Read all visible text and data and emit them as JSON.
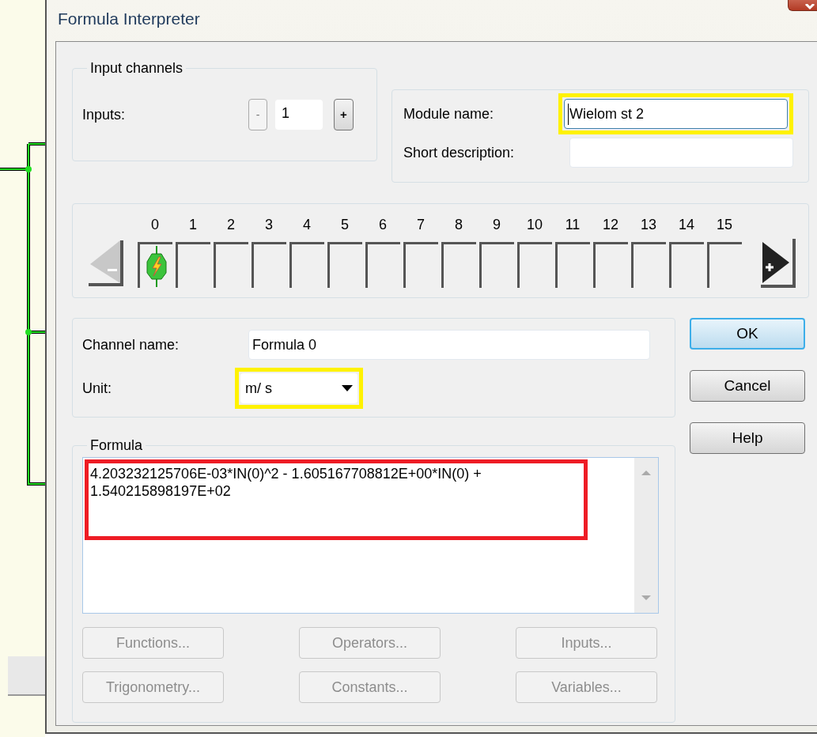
{
  "window": {
    "title": "Formula Interpreter"
  },
  "input_channels": {
    "title": "Input channels",
    "label": "Inputs:",
    "decrement": "-",
    "value": "1",
    "increment": "+"
  },
  "module": {
    "name_label": "Module name:",
    "name_value": "Wielom st 2",
    "name_focused": true,
    "name_highlighted": true,
    "description_label": "Short description:"
  },
  "channels": [
    {
      "label": "0",
      "active": true
    },
    {
      "label": "1",
      "active": false
    },
    {
      "label": "2",
      "active": false
    },
    {
      "label": "3",
      "active": false
    },
    {
      "label": "4",
      "active": false
    },
    {
      "label": "5",
      "active": false
    },
    {
      "label": "6",
      "active": false
    },
    {
      "label": "7",
      "active": false
    },
    {
      "label": "8",
      "active": false
    },
    {
      "label": "9",
      "active": false
    },
    {
      "label": "10",
      "active": false
    },
    {
      "label": "11",
      "active": false
    },
    {
      "label": "12",
      "active": false
    },
    {
      "label": "13",
      "active": false
    },
    {
      "label": "14",
      "active": false
    },
    {
      "label": "15",
      "active": false
    }
  ],
  "channel": {
    "name_label": "Channel name:",
    "name_value": "Formula 0",
    "unit_label": "Unit:",
    "unit_value": "m/ s",
    "unit_highlighted": true
  },
  "formula": {
    "title": "Formula",
    "text": "4.203232125706E-03*IN(0)^2 - 1.605167708812E+00*IN(0) + 1.540215898197E+02",
    "highlighted": true,
    "buttons": [
      {
        "label": "Functions...",
        "disabled": true
      },
      {
        "label": "Operators...",
        "disabled": true
      },
      {
        "label": "Inputs...",
        "disabled": true
      },
      {
        "label": "Trigonometry...",
        "disabled": true
      },
      {
        "label": "Constants...",
        "disabled": true
      },
      {
        "label": "Variables...",
        "disabled": true
      }
    ]
  },
  "buttons": [
    {
      "label": "OK",
      "default": true
    },
    {
      "label": "Cancel",
      "default": false
    },
    {
      "label": "Help",
      "default": false
    }
  ]
}
